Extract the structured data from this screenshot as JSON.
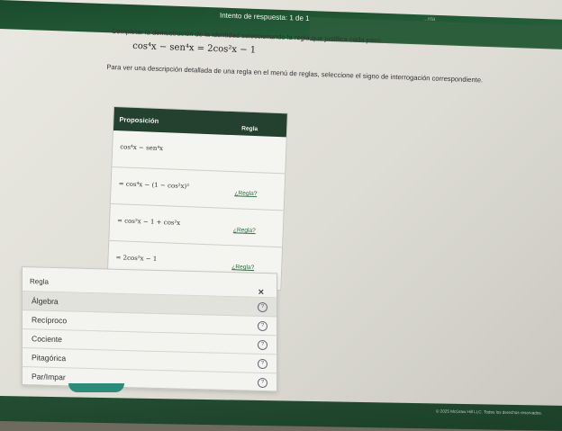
{
  "header": {
    "attempt_label": "Intento de respuesta: 1 de 1",
    "faint_text": "...nta"
  },
  "question": {
    "instruction": "Completar la demostración de la identidad seleccionando la regla que justifica cada paso.",
    "identity": "cos⁴x − sen⁴x = 2cos²x − 1",
    "help_text": "Para ver una descripción detallada de una regla en el menú de reglas, seleccione el signo de interrogación correspondiente."
  },
  "table": {
    "headers": {
      "proposition": "Proposición",
      "rule": "Regla"
    },
    "rows": [
      {
        "proposition": "cos⁴x − sen⁴x",
        "rule": ""
      },
      {
        "proposition": "= cos⁴x − (1 − cos²x)²",
        "rule": "¿Regla?"
      },
      {
        "proposition": "= cos²x − 1 + cos²x",
        "rule": "¿Regla?"
      },
      {
        "proposition": "= 2cos²x − 1",
        "rule": "¿Regla?"
      }
    ]
  },
  "rule_menu": {
    "title": "Regla",
    "close_symbol": "×",
    "help_symbol": "?",
    "items": [
      {
        "label": "Álgebra",
        "selected": true
      },
      {
        "label": "Recíproco",
        "selected": false
      },
      {
        "label": "Cociente",
        "selected": false
      },
      {
        "label": "Pitagórica",
        "selected": false
      },
      {
        "label": "Par/Impar",
        "selected": false
      }
    ]
  },
  "footer": {
    "text": "© 2025 McGraw Hill LLC. Todos los derechos reservados."
  },
  "colors": {
    "header_green": "#235a37",
    "table_header": "#24402f",
    "link_green": "#2f6b3e",
    "button_teal": "#2e8b7a"
  }
}
